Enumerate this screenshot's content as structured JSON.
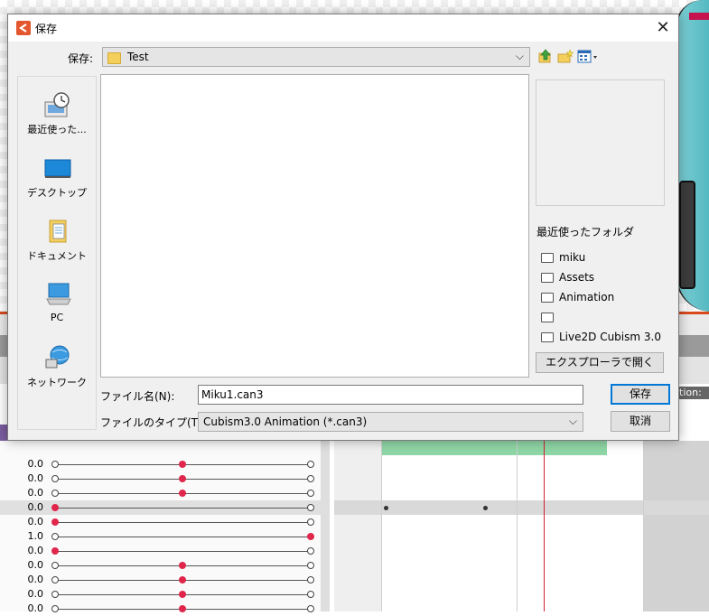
{
  "dialog": {
    "title": "保存",
    "close_glyph": "✕",
    "save_in_label": "保存:",
    "current_folder": "Test",
    "places": [
      {
        "label": "最近使った...",
        "icon": "recent-places-icon"
      },
      {
        "label": "デスクトップ",
        "icon": "desktop-icon"
      },
      {
        "label": "ドキュメント",
        "icon": "documents-icon"
      },
      {
        "label": "PC",
        "icon": "pc-icon"
      },
      {
        "label": "ネットワーク",
        "icon": "network-icon"
      }
    ],
    "recent_folders_title": "最近使ったフォルダ",
    "recent_folders": [
      "miku",
      "Assets",
      "Animation",
      "",
      "Live2D Cubism 3.0"
    ],
    "explorer_button": "エクスプローラで開く",
    "filename_label": "ファイル名(N):",
    "filename_value": "Miku1.can3",
    "filetype_label": "ファイルのタイプ(T):",
    "filetype_value": "Cubism3.0 Animation (*.can3)",
    "save_button": "保存",
    "cancel_button": "取消"
  },
  "background": {
    "station_text": "tion:",
    "param_values": [
      "0.0",
      "0.0",
      "0.0",
      "0.0",
      "0.0",
      "1.0",
      "0.0",
      "0.0",
      "0.0",
      "0.0",
      "0.0"
    ]
  },
  "colors": {
    "keyframe": "#e0264b",
    "timeline_green": "#8fd6a6",
    "playhead": "#d41e2e",
    "accent": "#0078d7"
  }
}
